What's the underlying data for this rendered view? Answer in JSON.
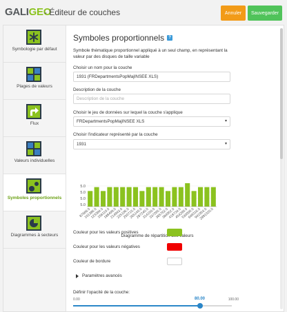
{
  "header": {
    "logo_gali": "GALI",
    "logo_geo": "GEO",
    "title": "- Éditeur de couches",
    "cancel_label": "Annuler",
    "save_label": "Sauvegarder",
    "cancel_color": "#f29b18",
    "save_color": "#50c35a"
  },
  "sidebar": {
    "items": [
      {
        "label": "Symbologie par défaut",
        "icon": "asterisk-icon"
      },
      {
        "label": "Plages de valeurs",
        "icon": "value-ranges-icon"
      },
      {
        "label": "Flux",
        "icon": "flux-arrow-icon"
      },
      {
        "label": "Valeurs individuelles",
        "icon": "individual-values-icon"
      },
      {
        "label": "Symboles proportionnels",
        "icon": "proportional-symbols-icon",
        "active": true
      },
      {
        "label": "Diagrammes à secteurs",
        "icon": "pie-chart-icon"
      }
    ]
  },
  "main": {
    "title": "Symboles proportionnels",
    "help": "?",
    "description": "Symbole thématique proportionnel appliqué à un seul champ, en représentant la valeur par des disques de taille variable",
    "name_label": "Choisir un nom pour la couche",
    "name_value": "1931 (FRDepartmentsPopMajINSEE XLS)",
    "desc_label": "Description de la couche",
    "desc_placeholder": "Description de la couche",
    "dataset_label": "Choisir le jeu de données sur lequel la couche s'applique",
    "dataset_value": "FRDepartmentsPopMajINSEE XLS",
    "indicator_label": "Choisir l'indicateur représenté par la couche",
    "indicator_value": "1931",
    "chart_caption": "Diagramme de répartition des valeurs",
    "pos_label": "Couleur pour les valeurs positives",
    "neg_label": "Couleur pour les valeurs négatives",
    "border_label": "Couleur de bordure",
    "pos_color": "#8bc21f",
    "neg_color": "#f00000",
    "border_color": "#ffffff",
    "advanced_label": "Paramètres avancés",
    "opacity_label": "Définir l'opacité de la couche:",
    "opacity_min": "0.00",
    "opacity_value": "80.00",
    "opacity_max": "100.00",
    "opacity_fraction": 0.8
  },
  "chart_data": {
    "type": "bar",
    "bar_color": "#8bc21f",
    "yticks": [
      "5.0",
      "5.0",
      "5.0",
      "5.0"
    ],
    "categories": [
      "87666.0",
      "101386.0",
      "123384.0",
      "156110.0",
      "188499.0",
      "214843.0",
      "225106.0",
      "250715.0",
      "265140.0",
      "287240.0",
      "314150.0",
      "337265.0",
      "365762.0",
      "384952.0",
      "418734.0",
      "454290.0",
      "530000.0",
      "649316.0",
      "941953.0",
      "2891020.0"
    ],
    "values": [
      4,
      5,
      4,
      5,
      5,
      5,
      5,
      5,
      4,
      5,
      5,
      5,
      4,
      5,
      5,
      6,
      4,
      5,
      5,
      5
    ],
    "xlabel": "Diagramme de répartition des valeurs"
  }
}
